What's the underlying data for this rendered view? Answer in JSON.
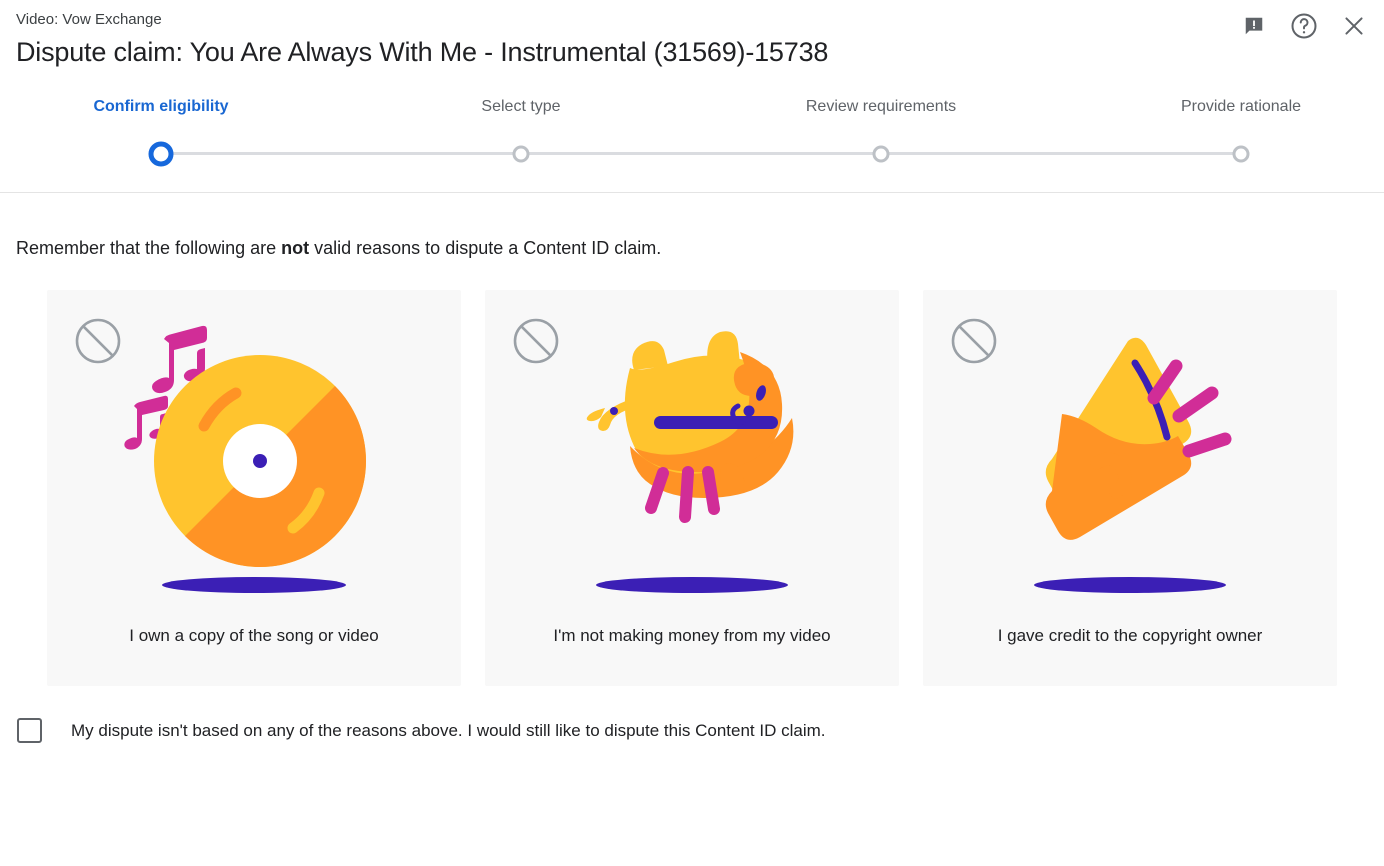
{
  "header": {
    "video_label": "Video: Vow Exchange",
    "title": "Dispute claim: You Are Always With Me - Instrumental (31569)-15738",
    "actions": [
      {
        "name": "feedback-icon",
        "label": "Send feedback"
      },
      {
        "name": "help-icon",
        "label": "Help"
      },
      {
        "name": "close-icon",
        "label": "Close"
      }
    ]
  },
  "stepper": {
    "active_index": 0,
    "steps": [
      {
        "label": "Confirm eligibility",
        "state": "active"
      },
      {
        "label": "Select type",
        "state": "pending"
      },
      {
        "label": "Review requirements",
        "state": "pending"
      },
      {
        "label": "Provide rationale",
        "state": "pending"
      }
    ]
  },
  "main": {
    "intro_before": "Remember that the following are ",
    "intro_bold": "not",
    "intro_after": " valid reasons to dispute a Content ID claim.",
    "cards": [
      {
        "label": "I own a copy of the song or video",
        "art": "vinyl-record"
      },
      {
        "label": "I'm not making money from my video",
        "art": "piggy-bank"
      },
      {
        "label": "I gave credit to the copyright owner",
        "art": "megaphone"
      }
    ],
    "checkbox": {
      "checked": false,
      "label": "My dispute isn't based on any of the reasons above. I would still like to dispute this Content ID claim."
    }
  },
  "colors": {
    "accent_blue": "#1668dc",
    "active_label_blue": "#1967d2",
    "track_grey": "#dadce0",
    "card_bg": "#f8f8f8",
    "art_yellow": "#ffc42e",
    "art_orange": "#ff9325",
    "art_pink": "#d12d97",
    "art_purple": "#3b1fb5",
    "text_primary": "#202124",
    "text_secondary": "#5f6368"
  }
}
